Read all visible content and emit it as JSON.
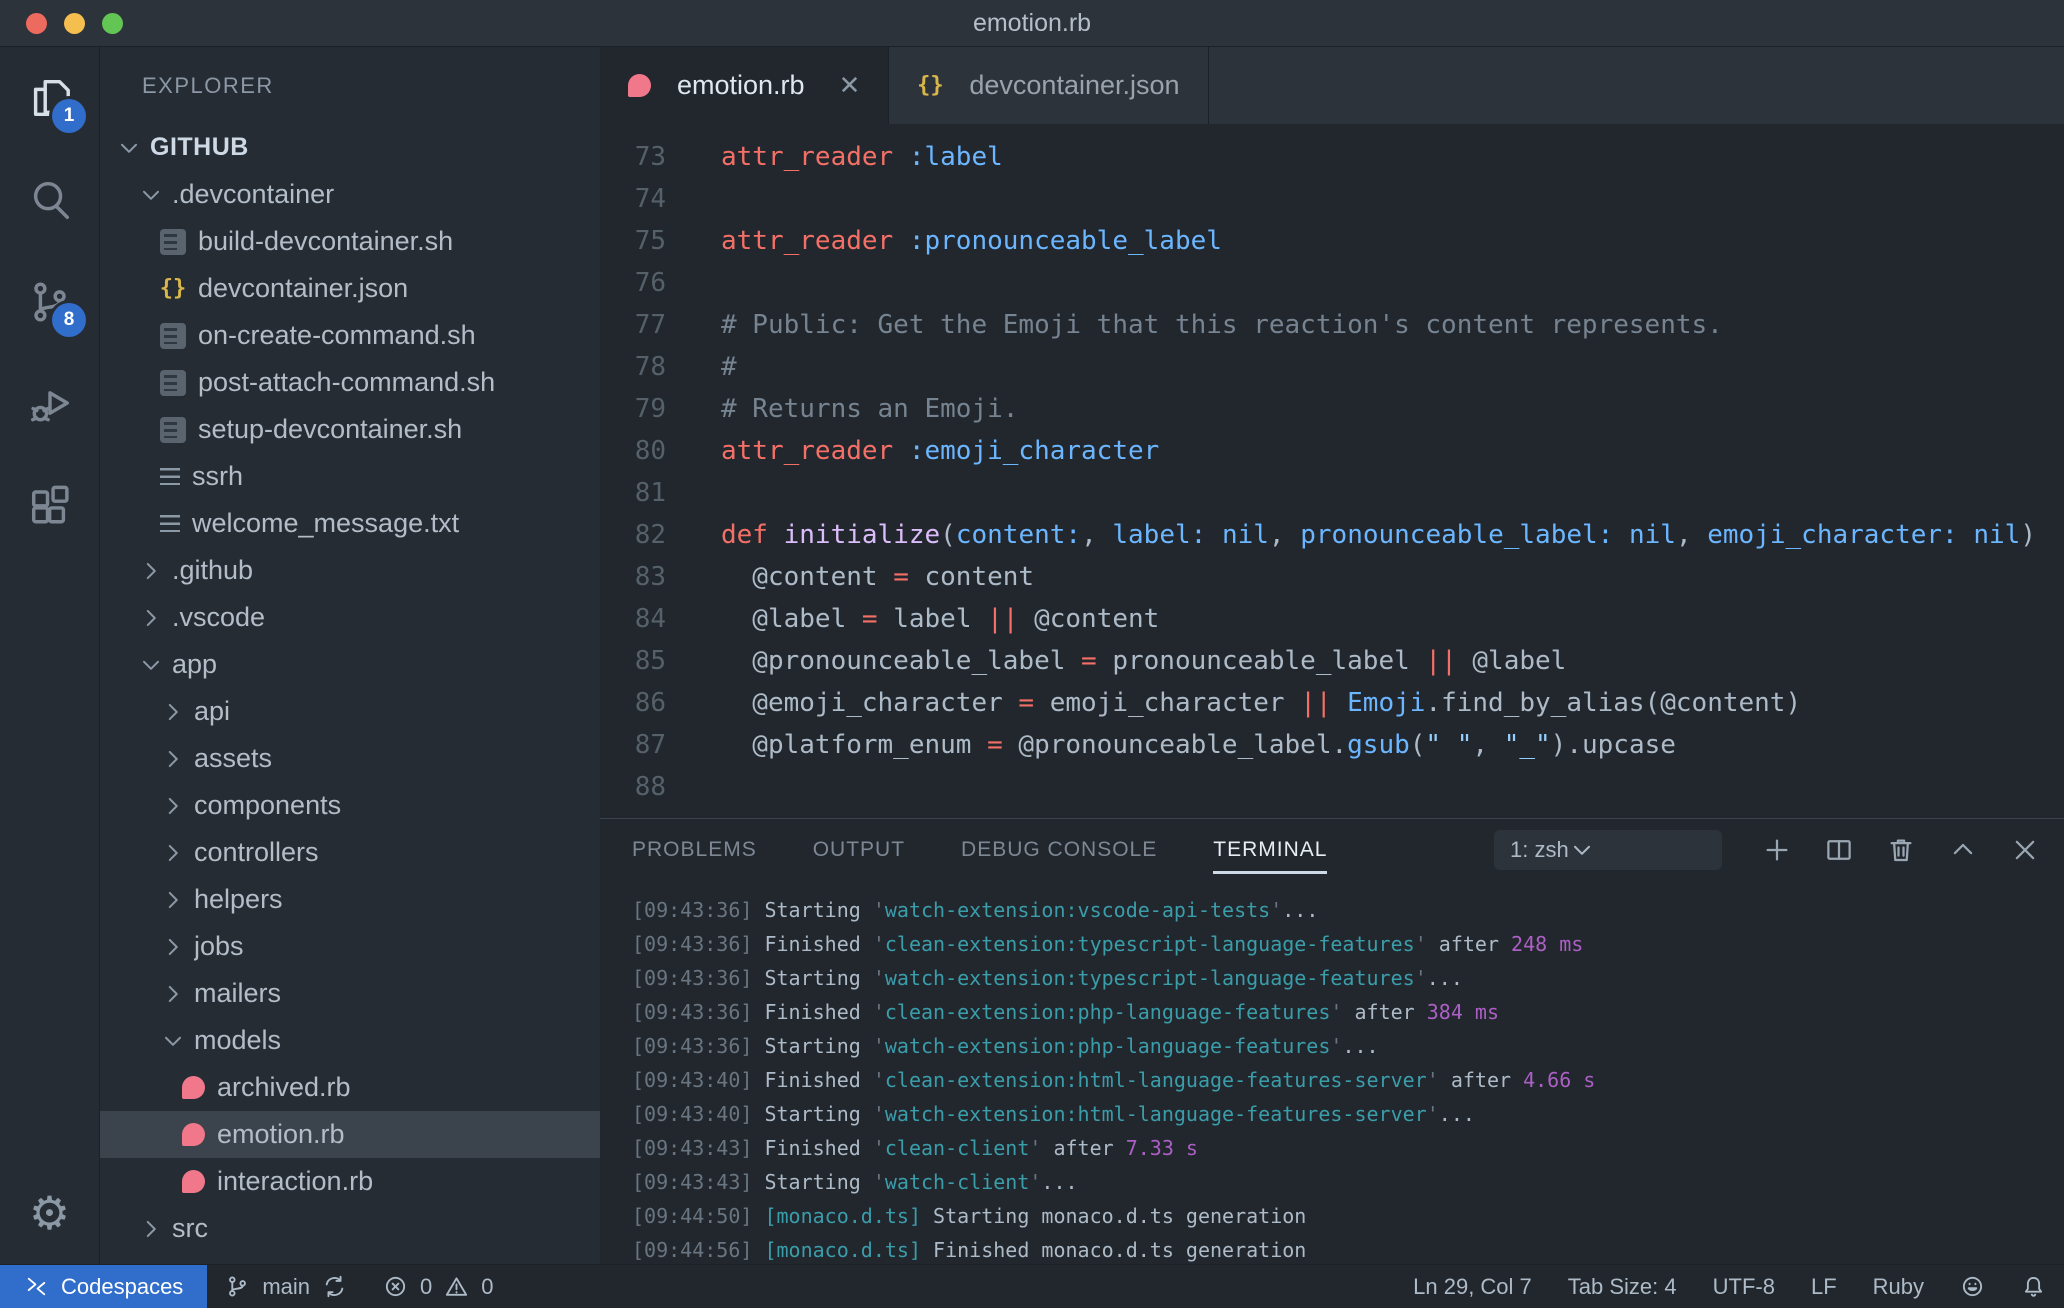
{
  "colors": {
    "accent_blue": "#316dca",
    "editor_bg": "#22272e",
    "sidebar_bg": "#262c34",
    "titlebar_bg": "#2d333b",
    "ruby_icon": "#f0788a",
    "json_icon": "#d9b64a",
    "traffic_red": "#ed6a5e",
    "traffic_yellow": "#f5bf4f",
    "traffic_green": "#62c554"
  },
  "window": {
    "title": "emotion.rb"
  },
  "activity_bar": {
    "items": [
      {
        "id": "explorer",
        "icon": "files",
        "badge": "1",
        "active": true
      },
      {
        "id": "search",
        "icon": "search",
        "active": false
      },
      {
        "id": "source-control",
        "icon": "source-control",
        "badge": "8",
        "active": false
      },
      {
        "id": "run-debug",
        "icon": "debug",
        "active": false
      },
      {
        "id": "extensions",
        "icon": "extensions",
        "active": false
      }
    ],
    "bottom": [
      {
        "id": "settings",
        "icon": "gear"
      }
    ]
  },
  "sidebar": {
    "header": "EXPLORER",
    "tree": [
      {
        "label": "GITHUB",
        "level": 0,
        "kind": "folder",
        "expanded": true,
        "root": true
      },
      {
        "label": ".devcontainer",
        "level": 1,
        "kind": "folder",
        "expanded": true
      },
      {
        "label": "build-devcontainer.sh",
        "level": 2,
        "kind": "file",
        "icon": "sh"
      },
      {
        "label": "devcontainer.json",
        "level": 2,
        "kind": "file",
        "icon": "json"
      },
      {
        "label": "on-create-command.sh",
        "level": 2,
        "kind": "file",
        "icon": "sh"
      },
      {
        "label": "post-attach-command.sh",
        "level": 2,
        "kind": "file",
        "icon": "sh"
      },
      {
        "label": "setup-devcontainer.sh",
        "level": 2,
        "kind": "file",
        "icon": "sh"
      },
      {
        "label": "ssrh",
        "level": 2,
        "kind": "file",
        "icon": "lines"
      },
      {
        "label": "welcome_message.txt",
        "level": 2,
        "kind": "file",
        "icon": "lines"
      },
      {
        "label": ".github",
        "level": 1,
        "kind": "folder",
        "expanded": false
      },
      {
        "label": ".vscode",
        "level": 1,
        "kind": "folder",
        "expanded": false
      },
      {
        "label": "app",
        "level": 1,
        "kind": "folder",
        "expanded": true
      },
      {
        "label": "api",
        "level": 2,
        "kind": "folder",
        "expanded": false
      },
      {
        "label": "assets",
        "level": 2,
        "kind": "folder",
        "expanded": false
      },
      {
        "label": "components",
        "level": 2,
        "kind": "folder",
        "expanded": false
      },
      {
        "label": "controllers",
        "level": 2,
        "kind": "folder",
        "expanded": false
      },
      {
        "label": "helpers",
        "level": 2,
        "kind": "folder",
        "expanded": false
      },
      {
        "label": "jobs",
        "level": 2,
        "kind": "folder",
        "expanded": false
      },
      {
        "label": "mailers",
        "level": 2,
        "kind": "folder",
        "expanded": false
      },
      {
        "label": "models",
        "level": 2,
        "kind": "folder",
        "expanded": true
      },
      {
        "label": "archived.rb",
        "level": 3,
        "kind": "file",
        "icon": "ruby"
      },
      {
        "label": "emotion.rb",
        "level": 3,
        "kind": "file",
        "icon": "ruby",
        "selected": true
      },
      {
        "label": "interaction.rb",
        "level": 3,
        "kind": "file",
        "icon": "ruby"
      },
      {
        "label": "src",
        "level": 1,
        "kind": "folder",
        "expanded": false
      }
    ]
  },
  "editor": {
    "tabs": [
      {
        "label": "emotion.rb",
        "icon": "ruby",
        "active": true,
        "closable": true
      },
      {
        "label": "devcontainer.json",
        "icon": "json",
        "active": false,
        "closable": false
      }
    ],
    "lines": [
      {
        "n": "73",
        "t": [
          [
            "attr_reader",
            "red"
          ],
          [
            " ",
            "fg"
          ],
          [
            ":label",
            "blue"
          ]
        ]
      },
      {
        "n": "74",
        "t": []
      },
      {
        "n": "75",
        "t": [
          [
            "attr_reader",
            "red"
          ],
          [
            " ",
            "fg"
          ],
          [
            ":pronounceable_label",
            "blue"
          ]
        ]
      },
      {
        "n": "76",
        "t": []
      },
      {
        "n": "77",
        "t": [
          [
            "# Public: Get the Emoji that this reaction's content represents.",
            "com"
          ]
        ]
      },
      {
        "n": "78",
        "t": [
          [
            "#",
            "com"
          ]
        ]
      },
      {
        "n": "79",
        "t": [
          [
            "# Returns an Emoji.",
            "com"
          ]
        ]
      },
      {
        "n": "80",
        "t": [
          [
            "attr_reader",
            "red"
          ],
          [
            " ",
            "fg"
          ],
          [
            ":emoji_character",
            "blue"
          ]
        ]
      },
      {
        "n": "81",
        "t": []
      },
      {
        "n": "82",
        "t": [
          [
            "def",
            "red"
          ],
          [
            " ",
            "fg"
          ],
          [
            "initialize",
            "purple"
          ],
          [
            "(",
            "fg"
          ],
          [
            "content:",
            "blue"
          ],
          [
            ", ",
            "fg"
          ],
          [
            "label:",
            "blue"
          ],
          [
            " ",
            "fg"
          ],
          [
            "nil",
            "blue"
          ],
          [
            ", ",
            "fg"
          ],
          [
            "pronounceable_label:",
            "blue"
          ],
          [
            " ",
            "fg"
          ],
          [
            "nil",
            "blue"
          ],
          [
            ", ",
            "fg"
          ],
          [
            "emoji_character:",
            "blue"
          ],
          [
            " ",
            "fg"
          ],
          [
            "nil",
            "blue"
          ],
          [
            ")",
            "fg"
          ]
        ]
      },
      {
        "n": "83",
        "t": [
          [
            "  @content ",
            "fg"
          ],
          [
            "=",
            "red"
          ],
          [
            " content",
            "fg"
          ]
        ]
      },
      {
        "n": "84",
        "t": [
          [
            "  @label ",
            "fg"
          ],
          [
            "=",
            "red"
          ],
          [
            " label ",
            "fg"
          ],
          [
            "||",
            "red"
          ],
          [
            " @content",
            "fg"
          ]
        ]
      },
      {
        "n": "85",
        "t": [
          [
            "  @pronounceable_label ",
            "fg"
          ],
          [
            "=",
            "red"
          ],
          [
            " pronounceable_label ",
            "fg"
          ],
          [
            "||",
            "red"
          ],
          [
            " @label",
            "fg"
          ]
        ]
      },
      {
        "n": "86",
        "t": [
          [
            "  @emoji_character ",
            "fg"
          ],
          [
            "=",
            "red"
          ],
          [
            " emoji_character ",
            "fg"
          ],
          [
            "||",
            "red"
          ],
          [
            " ",
            "fg"
          ],
          [
            "Emoji",
            "blue"
          ],
          [
            ".find_by_alias(@content)",
            "fg"
          ]
        ]
      },
      {
        "n": "87",
        "t": [
          [
            "  @platform_enum ",
            "fg"
          ],
          [
            "=",
            "red"
          ],
          [
            " @pronounceable_label.",
            "fg"
          ],
          [
            "gsub",
            "blue"
          ],
          [
            "(",
            "fg"
          ],
          [
            "\" \"",
            "str"
          ],
          [
            ", ",
            "fg"
          ],
          [
            "\"_\"",
            "str"
          ],
          [
            ").upcase",
            "fg"
          ]
        ]
      },
      {
        "n": "88",
        "t": []
      }
    ]
  },
  "panel": {
    "tabs": [
      {
        "label": "PROBLEMS",
        "active": false
      },
      {
        "label": "OUTPUT",
        "active": false
      },
      {
        "label": "DEBUG CONSOLE",
        "active": false
      },
      {
        "label": "TERMINAL",
        "active": true
      }
    ],
    "shell_select": {
      "value": "1: zsh"
    },
    "actions": [
      {
        "id": "new-terminal",
        "icon": "plus"
      },
      {
        "id": "split-terminal",
        "icon": "split"
      },
      {
        "id": "kill-terminal",
        "icon": "trash"
      },
      {
        "id": "maximize-panel",
        "icon": "chevron-up"
      },
      {
        "id": "close-panel",
        "icon": "close"
      }
    ],
    "terminal_lines": [
      [
        [
          "[09:43:36] ",
          "dim"
        ],
        [
          "Starting ",
          "fg"
        ],
        [
          "'",
          "dim"
        ],
        [
          "watch-extension:vscode-api-tests",
          "teal"
        ],
        [
          "'",
          "dim"
        ],
        [
          "...",
          "fg"
        ]
      ],
      [
        [
          "[09:43:36] ",
          "dim"
        ],
        [
          "Finished ",
          "fg"
        ],
        [
          "'",
          "dim"
        ],
        [
          "clean-extension:typescript-language-features",
          "teal"
        ],
        [
          "'",
          "dim"
        ],
        [
          " after ",
          "fg"
        ],
        [
          "248 ms",
          "mag"
        ]
      ],
      [
        [
          "[09:43:36] ",
          "dim"
        ],
        [
          "Starting ",
          "fg"
        ],
        [
          "'",
          "dim"
        ],
        [
          "watch-extension:typescript-language-features",
          "teal"
        ],
        [
          "'",
          "dim"
        ],
        [
          "...",
          "fg"
        ]
      ],
      [
        [
          "[09:43:36] ",
          "dim"
        ],
        [
          "Finished ",
          "fg"
        ],
        [
          "'",
          "dim"
        ],
        [
          "clean-extension:php-language-features",
          "teal"
        ],
        [
          "'",
          "dim"
        ],
        [
          " after ",
          "fg"
        ],
        [
          "384 ms",
          "mag"
        ]
      ],
      [
        [
          "[09:43:36] ",
          "dim"
        ],
        [
          "Starting ",
          "fg"
        ],
        [
          "'",
          "dim"
        ],
        [
          "watch-extension:php-language-features",
          "teal"
        ],
        [
          "'",
          "dim"
        ],
        [
          "...",
          "fg"
        ]
      ],
      [
        [
          "[09:43:40] ",
          "dim"
        ],
        [
          "Finished ",
          "fg"
        ],
        [
          "'",
          "dim"
        ],
        [
          "clean-extension:html-language-features-server",
          "teal"
        ],
        [
          "'",
          "dim"
        ],
        [
          " after ",
          "fg"
        ],
        [
          "4.66 s",
          "mag"
        ]
      ],
      [
        [
          "[09:43:40] ",
          "dim"
        ],
        [
          "Starting ",
          "fg"
        ],
        [
          "'",
          "dim"
        ],
        [
          "watch-extension:html-language-features-server",
          "teal"
        ],
        [
          "'",
          "dim"
        ],
        [
          "...",
          "fg"
        ]
      ],
      [
        [
          "[09:43:43] ",
          "dim"
        ],
        [
          "Finished ",
          "fg"
        ],
        [
          "'",
          "dim"
        ],
        [
          "clean-client",
          "teal"
        ],
        [
          "'",
          "dim"
        ],
        [
          " after ",
          "fg"
        ],
        [
          "7.33 s",
          "mag"
        ]
      ],
      [
        [
          "[09:43:43] ",
          "dim"
        ],
        [
          "Starting ",
          "fg"
        ],
        [
          "'",
          "dim"
        ],
        [
          "watch-client",
          "teal"
        ],
        [
          "'",
          "dim"
        ],
        [
          "...",
          "fg"
        ]
      ],
      [
        [
          "[09:44:50] ",
          "dim"
        ],
        [
          "[monaco.d.ts]",
          "teal"
        ],
        [
          " Starting monaco.d.ts generation",
          "fg"
        ]
      ],
      [
        [
          "[09:44:56] ",
          "dim"
        ],
        [
          "[monaco.d.ts]",
          "teal"
        ],
        [
          " Finished monaco.d.ts generation",
          "fg"
        ]
      ]
    ]
  },
  "status_bar": {
    "left": [
      {
        "id": "codespaces",
        "accent": true,
        "pieces": [
          {
            "i": "remote"
          },
          {
            "t": "Codespaces"
          }
        ]
      },
      {
        "id": "branch",
        "pieces": [
          {
            "i": "branch"
          },
          {
            "t": "main"
          },
          {
            "i": "sync"
          }
        ]
      },
      {
        "id": "problems",
        "pieces": [
          {
            "i": "error"
          },
          {
            "t": "0"
          },
          {
            "i": "warning"
          },
          {
            "t": "0"
          }
        ]
      }
    ],
    "right": [
      {
        "id": "cursor-position",
        "pieces": [
          {
            "t": "Ln 29, Col 7"
          }
        ]
      },
      {
        "id": "tab-size",
        "pieces": [
          {
            "t": "Tab Size: 4"
          }
        ]
      },
      {
        "id": "encoding",
        "pieces": [
          {
            "t": "UTF-8"
          }
        ]
      },
      {
        "id": "eol",
        "pieces": [
          {
            "t": "LF"
          }
        ]
      },
      {
        "id": "language-mode",
        "pieces": [
          {
            "t": "Ruby"
          }
        ]
      },
      {
        "id": "feedback",
        "pieces": [
          {
            "i": "smiley"
          }
        ]
      },
      {
        "id": "notifications",
        "pieces": [
          {
            "i": "bell"
          }
        ]
      }
    ]
  }
}
